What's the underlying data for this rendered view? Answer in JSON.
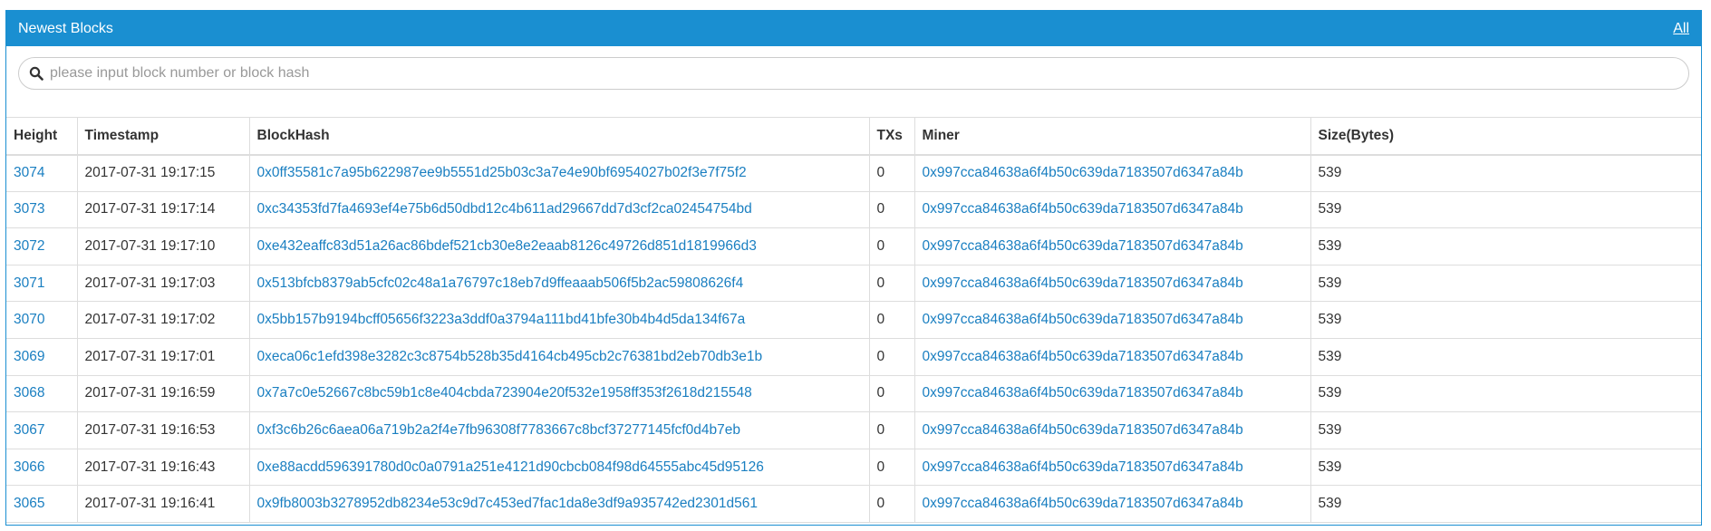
{
  "panel": {
    "title": "Newest Blocks",
    "all_label": "All",
    "header_color": "#1a8fd1"
  },
  "search": {
    "placeholder": "please input block number or block hash",
    "value": "",
    "icon": "search-icon"
  },
  "table": {
    "headers": {
      "height": "Height",
      "timestamp": "Timestamp",
      "blockhash": "BlockHash",
      "txs": "TXs",
      "miner": "Miner",
      "size": "Size(Bytes)"
    },
    "rows": [
      {
        "height": "3074",
        "timestamp": "2017-07-31 19:17:15",
        "blockhash": "0x0ff35581c7a95b622987ee9b5551d25b03c3a7e4e90bf6954027b02f3e7f75f2",
        "txs": "0",
        "miner": "0x997cca84638a6f4b50c639da7183507d6347a84b",
        "size": "539"
      },
      {
        "height": "3073",
        "timestamp": "2017-07-31 19:17:14",
        "blockhash": "0xc34353fd7fa4693ef4e75b6d50dbd12c4b611ad29667dd7d3cf2ca02454754bd",
        "txs": "0",
        "miner": "0x997cca84638a6f4b50c639da7183507d6347a84b",
        "size": "539"
      },
      {
        "height": "3072",
        "timestamp": "2017-07-31 19:17:10",
        "blockhash": "0xe432eaffc83d51a26ac86bdef521cb30e8e2eaab8126c49726d851d1819966d3",
        "txs": "0",
        "miner": "0x997cca84638a6f4b50c639da7183507d6347a84b",
        "size": "539"
      },
      {
        "height": "3071",
        "timestamp": "2017-07-31 19:17:03",
        "blockhash": "0x513bfcb8379ab5cfc02c48a1a76797c18eb7d9ffeaaab506f5b2ac59808626f4",
        "txs": "0",
        "miner": "0x997cca84638a6f4b50c639da7183507d6347a84b",
        "size": "539"
      },
      {
        "height": "3070",
        "timestamp": "2017-07-31 19:17:02",
        "blockhash": "0x5bb157b9194bcff05656f3223a3ddf0a3794a111bd41bfe30b4b4d5da134f67a",
        "txs": "0",
        "miner": "0x997cca84638a6f4b50c639da7183507d6347a84b",
        "size": "539"
      },
      {
        "height": "3069",
        "timestamp": "2017-07-31 19:17:01",
        "blockhash": "0xeca06c1efd398e3282c3c8754b528b35d4164cb495cb2c76381bd2eb70db3e1b",
        "txs": "0",
        "miner": "0x997cca84638a6f4b50c639da7183507d6347a84b",
        "size": "539"
      },
      {
        "height": "3068",
        "timestamp": "2017-07-31 19:16:59",
        "blockhash": "0x7a7c0e52667c8bc59b1c8e404cbda723904e20f532e1958ff353f2618d215548",
        "txs": "0",
        "miner": "0x997cca84638a6f4b50c639da7183507d6347a84b",
        "size": "539"
      },
      {
        "height": "3067",
        "timestamp": "2017-07-31 19:16:53",
        "blockhash": "0xf3c6b26c6aea06a719b2a2f4e7fb96308f7783667c8bcf37277145fcf0d4b7eb",
        "txs": "0",
        "miner": "0x997cca84638a6f4b50c639da7183507d6347a84b",
        "size": "539"
      },
      {
        "height": "3066",
        "timestamp": "2017-07-31 19:16:43",
        "blockhash": "0xe88acdd596391780d0c0a0791a251e4121d90cbcb084f98d64555abc45d95126",
        "txs": "0",
        "miner": "0x997cca84638a6f4b50c639da7183507d6347a84b",
        "size": "539"
      },
      {
        "height": "3065",
        "timestamp": "2017-07-31 19:16:41",
        "blockhash": "0x9fb8003b3278952db8234e53c9d7c453ed7fac1da8e3df9a935742ed2301d561",
        "txs": "0",
        "miner": "0x997cca84638a6f4b50c639da7183507d6347a84b",
        "size": "539"
      }
    ]
  }
}
